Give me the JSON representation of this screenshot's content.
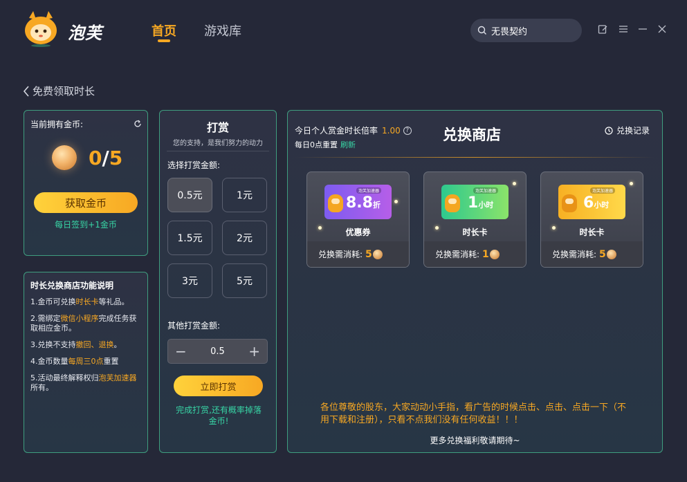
{
  "header": {
    "brand": "泡芙",
    "tabs": [
      {
        "label": "首页",
        "active": true
      },
      {
        "label": "游戏库",
        "active": false
      }
    ],
    "search_value": "无畏契约"
  },
  "back": {
    "label": "免费领取时长"
  },
  "coins": {
    "label": "当前拥有金币:",
    "current": "0",
    "separator": "/",
    "total": "5",
    "get_button": "获取金币",
    "daily_tip": "每日签到+1金币"
  },
  "info": {
    "title": "时长兑换商店功能说明",
    "items": [
      {
        "a": "1.金币可兑换",
        "b": "时长卡",
        "c": "等礼品。"
      },
      {
        "a": "2.需绑定",
        "b": "微信小程序",
        "c": "完成任务获取相应金币。"
      },
      {
        "a": "3.兑换不支持",
        "b": "撤回、退换",
        "c": "。"
      },
      {
        "a": "4.金币数量",
        "b": "每周三0点",
        "c": "重置"
      },
      {
        "a": "5.活动最终解释权归",
        "b": "泡芙加速器",
        "c": "所有。"
      }
    ]
  },
  "reward": {
    "title": "打赏",
    "subtitle": "您的支持，是我们努力的动力",
    "choose_label": "选择打赏金额:",
    "amounts": [
      "0.5元",
      "1元",
      "1.5元",
      "2元",
      "3元",
      "5元"
    ],
    "selected_index": 0,
    "other_label": "其他打赏金额:",
    "stepper_value": "0.5",
    "button": "立即打赏",
    "note": "完成打赏,还有概率掉落金币!"
  },
  "shop": {
    "rate_label": "今日个人赏金时长倍率",
    "rate_value": "1.00",
    "reset_label": "每日0点重置",
    "refresh_label": "刷新",
    "title": "兑换商店",
    "history_label": "兑换记录",
    "brand_tag": "泡芙加速器",
    "cards": [
      {
        "num": "8.8",
        "unit": "折",
        "name": "优惠券",
        "cost_label": "兑换需消耗:",
        "cost": "5",
        "color_from": "#7d5cf0",
        "color_to": "#b65ee8"
      },
      {
        "num": "1",
        "unit": "小时",
        "name": "时长卡",
        "cost_label": "兑换需消耗:",
        "cost": "1",
        "color_from": "#2ec98e",
        "color_to": "#8be36a"
      },
      {
        "num": "6",
        "unit": "小时",
        "name": "时长卡",
        "cost_label": "兑换需消耗:",
        "cost": "5",
        "color_from": "#f7b023",
        "color_to": "#ffd94a"
      }
    ],
    "notice": "各位尊敬的股东，大家动动小手指，看广告的时候点击、点击、点击一下（不用下载和注册），只看不点我们没有任何收益！！！",
    "more": "更多兑换福利敬请期待~"
  },
  "colors": {
    "accent": "#f7a823",
    "green": "#38d6a6",
    "border": "#3f9e7f"
  }
}
